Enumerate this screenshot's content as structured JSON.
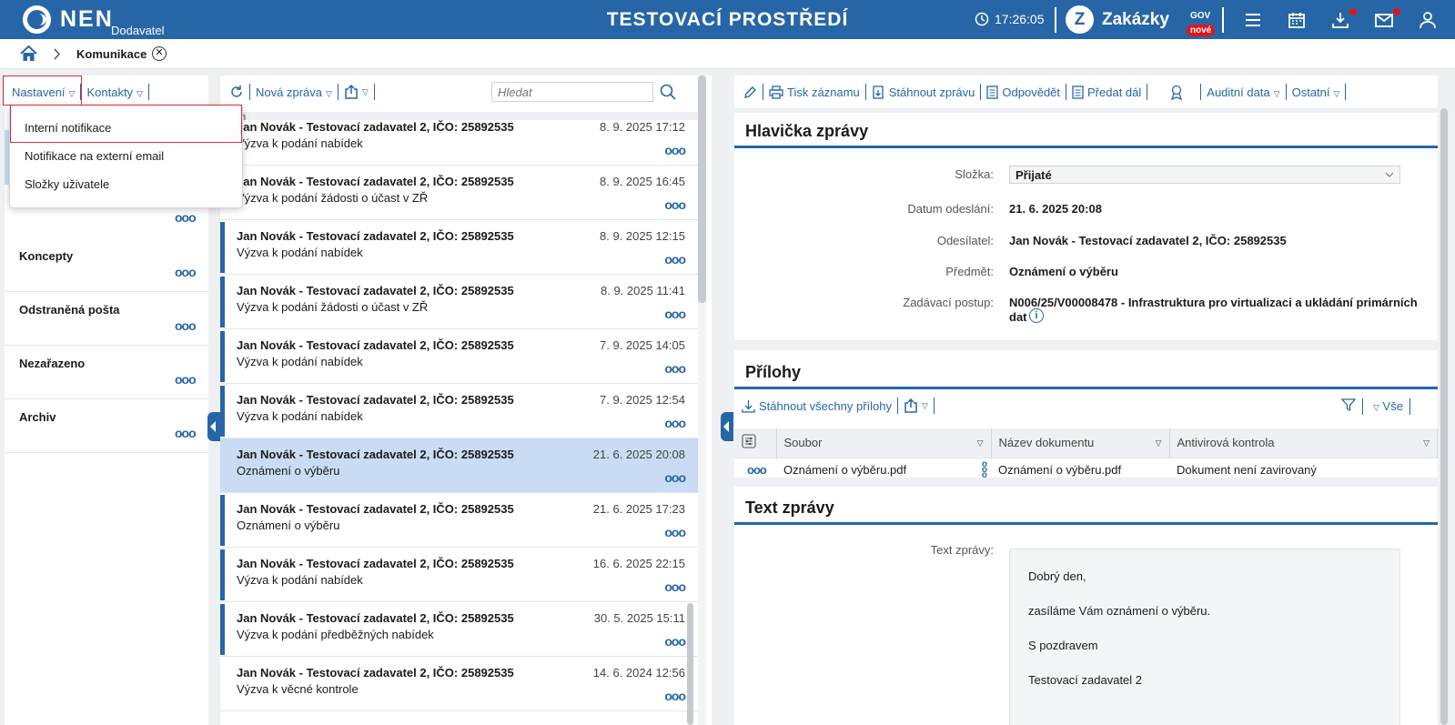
{
  "topbar": {
    "logo": "NEN",
    "logo_sub": "Dodavatel",
    "environment": "TESTOVACÍ PROSTŘEDÍ",
    "time": "17:26:05",
    "zakazky": "Zakázky",
    "zakazky_gov": "GOV",
    "zakazky_badge": "nové"
  },
  "breadcrumb": {
    "label": "Komunikace"
  },
  "left": {
    "toolbar": {
      "settings": "Nastavení",
      "contacts": "Kontakty"
    },
    "dropdown": [
      "Interní notifikace",
      "Notifikace na externí email",
      "Složky uživatele"
    ],
    "folders": [
      "Koncepty",
      "Odstraněná pošta",
      "Nezařazeno",
      "Archiv"
    ]
  },
  "middle": {
    "toolbar": {
      "new_message": "Nová zpráva",
      "search_placeholder": "Hledat"
    },
    "messages": [
      {
        "from": "Jan Novák - Testovací zadavatel 2, IČO: 25892535",
        "date": "8. 9. 2025 17:12",
        "subject": "Výzva k podání nabídek"
      },
      {
        "from": "Jan Novák - Testovací zadavatel 2, IČO: 25892535",
        "date": "8. 9. 2025 16:45",
        "subject": "Výzva k podání žádosti o účast v ZŘ"
      },
      {
        "from": "Jan Novák - Testovací zadavatel 2, IČO: 25892535",
        "date": "8. 9. 2025 12:15",
        "subject": "Výzva k podání nabídek"
      },
      {
        "from": "Jan Novák - Testovací zadavatel 2, IČO: 25892535",
        "date": "8. 9. 2025 11:41",
        "subject": "Výzva k podání žádosti o účast v ZŘ"
      },
      {
        "from": "Jan Novák - Testovací zadavatel 2, IČO: 25892535",
        "date": "7. 9. 2025 14:05",
        "subject": "Výzva k podání nabídek"
      },
      {
        "from": "Jan Novák - Testovací zadavatel 2, IČO: 25892535",
        "date": "7. 9. 2025 12:54",
        "subject": "Výzva k podání nabídek"
      },
      {
        "from": "Jan Novák - Testovací zadavatel 2, IČO: 25892535",
        "date": "21. 6. 2025 20:08",
        "subject": "Oznámení o výběru"
      },
      {
        "from": "Jan Novák - Testovací zadavatel 2, IČO: 25892535",
        "date": "21. 6. 2025 17:23",
        "subject": "Oznámení o výběru"
      },
      {
        "from": "Jan Novák - Testovací zadavatel 2, IČO: 25892535",
        "date": "16. 6. 2025 22:15",
        "subject": "Výzva k podání nabídek"
      },
      {
        "from": "Jan Novák - Testovací zadavatel 2, IČO: 25892535",
        "date": "30. 5. 2025 15:11",
        "subject": "Výzva k podání předběžných nabídek"
      },
      {
        "from": "Jan Novák - Testovací zadavatel 2, IČO: 25892535",
        "date": "14. 6. 2024 12:56",
        "subject": "Výzva k věcné kontrole"
      }
    ]
  },
  "right": {
    "toolbar": {
      "print": "Tisk záznamu",
      "download": "Stáhnout zprávu",
      "reply": "Odpovědět",
      "forward": "Předat dál",
      "audit": "Auditní data",
      "other": "Ostatní"
    },
    "header": {
      "title": "Hlavička zprávy",
      "folder_label": "Složka:",
      "folder_value": "Přijaté",
      "sent_label": "Datum odeslání:",
      "sent_value": "21. 6. 2025 20:08",
      "sender_label": "Odesílatel:",
      "sender_value": "Jan Novák - Testovací zadavatel 2, IČO: 25892535",
      "subject_label": "Předmět:",
      "subject_value": "Oznámení o výběru",
      "procedure_label": "Zadávací postup:",
      "procedure_value_1": "N006/25/V00008478 - Infrastruktura pro virtualizaci a ukládání primárních",
      "procedure_value_2": "dat"
    },
    "attachments": {
      "title": "Přílohy",
      "download_all": "Stáhnout všechny přílohy",
      "filter_all": "Vše",
      "columns": [
        "Soubor",
        "Název dokumentu",
        "Antivirová kontrola"
      ],
      "rows": [
        {
          "file": "Oznámení o výběru.pdf",
          "name": "Oznámení o výběru.pdf",
          "av": "Dokument není zavirovaný"
        }
      ]
    },
    "text": {
      "title": "Text zprávy",
      "label": "Text zprávy:",
      "lines": [
        "Dobrý den,",
        "zasíláme Vám oznámení o výběru.",
        "S pozdravem",
        "Testovací zadavatel 2"
      ]
    }
  },
  "colors": {
    "primary": "#2766a6",
    "selected": "#c9dcf3",
    "alert": "#e0151b"
  }
}
